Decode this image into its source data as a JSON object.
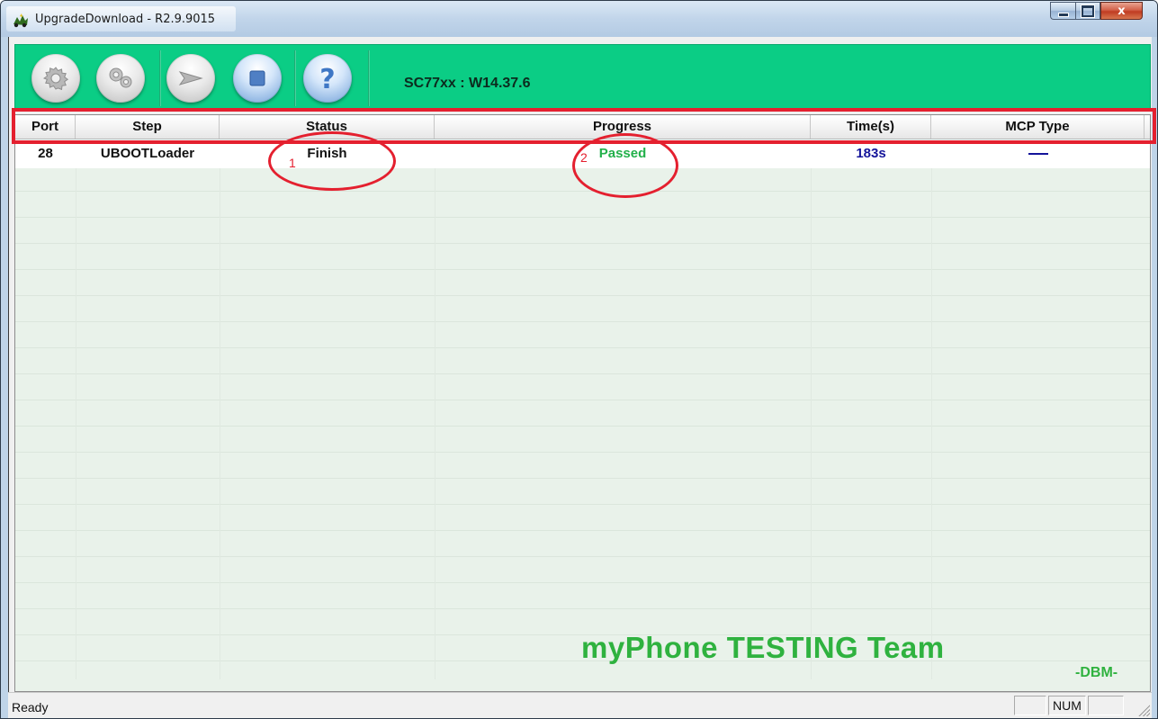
{
  "window": {
    "title": "UpgradeDownload - R2.9.9015",
    "minimize_label": "minimize",
    "maximize_label": "maximize",
    "close_label": "x"
  },
  "toolbar": {
    "buttons": [
      {
        "icon": "settings-gear-icon",
        "style": "grey"
      },
      {
        "icon": "multi-gear-icon",
        "style": "grey"
      },
      {
        "icon": "play-arrow-icon",
        "style": "grey"
      },
      {
        "icon": "stop-icon",
        "style": "blue"
      },
      {
        "icon": "help-question-icon",
        "style": "blue"
      }
    ],
    "device_label": "SC77xx : W14.37.6",
    "background_color": "#0bcd85"
  },
  "table": {
    "columns": [
      "Port",
      "Step",
      "Status",
      "Progress",
      "Time(s)",
      "MCP Type"
    ],
    "rows": [
      {
        "port": "28",
        "step": "UBOOTLoader",
        "status": "Finish",
        "progress": "Passed",
        "time": "183s",
        "mcp_type": "—"
      }
    ]
  },
  "annotations": {
    "status_marker": "1",
    "progress_marker": "2",
    "color": "#e4202f"
  },
  "watermark": {
    "text": "myPhone TESTING Team",
    "signature": "-DBM-",
    "color": "#2fb23f"
  },
  "statusbar": {
    "text": "Ready",
    "num_indicator": "NUM"
  }
}
